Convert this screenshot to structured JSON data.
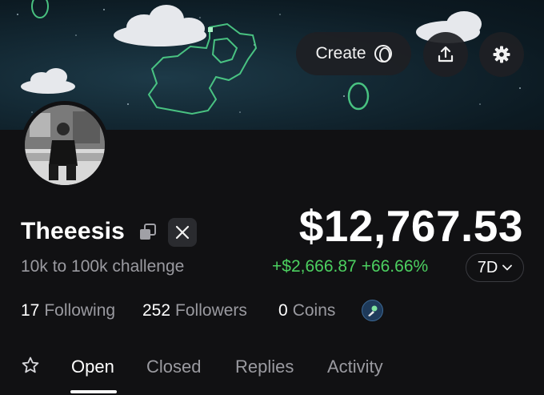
{
  "header": {
    "create_label": "Create",
    "icons": [
      "create-ring-icon",
      "share-upload-icon",
      "gear-icon"
    ]
  },
  "profile": {
    "name": "Theeesis",
    "bio": "10k to 100k challenge",
    "icons": [
      "copy-icon",
      "x-logo-icon"
    ]
  },
  "portfolio": {
    "balance": "$12,767.53",
    "change_amount": "+$2,666.87",
    "change_percent": "+66.66%",
    "period": "7D",
    "accent_color": "#4cd060"
  },
  "stats": {
    "following_count": "17",
    "following_label": "Following",
    "followers_count": "252",
    "followers_label": "Followers",
    "coins_count": "0",
    "coins_label": "Coins"
  },
  "tabs": [
    {
      "label": "Open",
      "active": true
    },
    {
      "label": "Closed",
      "active": false
    },
    {
      "label": "Replies",
      "active": false
    },
    {
      "label": "Activity",
      "active": false
    }
  ]
}
